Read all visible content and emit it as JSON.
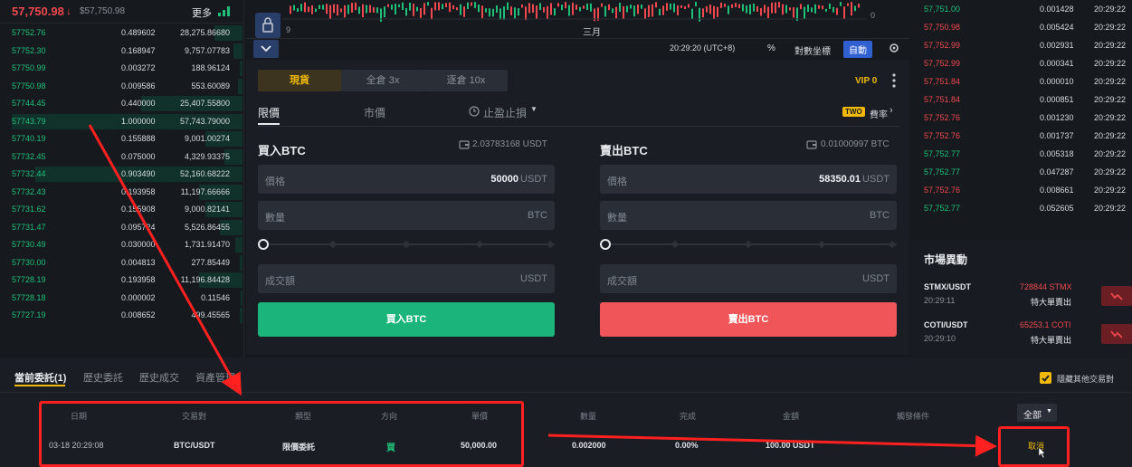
{
  "left_header": {
    "price": "57,750.98",
    "arrow": "↓",
    "sub_price": "$57,750.98",
    "more_label": "更多"
  },
  "left_book": [
    {
      "price": "57752.76",
      "amount": "0.489602",
      "total": "28,275.86680"
    },
    {
      "price": "57752.30",
      "amount": "0.168947",
      "total": "9,757.07783"
    },
    {
      "price": "57750.99",
      "amount": "0.003272",
      "total": "188.96124"
    },
    {
      "price": "57750.98",
      "amount": "0.009586",
      "total": "553.60089"
    },
    {
      "price": "57744.45",
      "amount": "0.440000",
      "total": "25,407.55800"
    },
    {
      "price": "57743.79",
      "amount": "1.000000",
      "total": "57,743.79000"
    },
    {
      "price": "57740.19",
      "amount": "0.155888",
      "total": "9,001.00274"
    },
    {
      "price": "57732.45",
      "amount": "0.075000",
      "total": "4,329.93375"
    },
    {
      "price": "57732.44",
      "amount": "0.903490",
      "total": "52,160.68222"
    },
    {
      "price": "57732.43",
      "amount": "0.193958",
      "total": "11,197.66666"
    },
    {
      "price": "57731.62",
      "amount": "0.155908",
      "total": "9,000.82141"
    },
    {
      "price": "57731.47",
      "amount": "0.095724",
      "total": "5,526.86455"
    },
    {
      "price": "57730.49",
      "amount": "0.030000",
      "total": "1,731.91470"
    },
    {
      "price": "57730.00",
      "amount": "0.004813",
      "total": "277.85449"
    },
    {
      "price": "57728.19",
      "amount": "0.193958",
      "total": "11,196.84428"
    },
    {
      "price": "57728.18",
      "amount": "0.000002",
      "total": "0.11546"
    },
    {
      "price": "57727.19",
      "amount": "0.008652",
      "total": "499.45565"
    }
  ],
  "left_book_depth": [
    0.12,
    0.04,
    0.01,
    0.02,
    0.44,
    1.0,
    0.16,
    0.08,
    0.9,
    0.19,
    0.16,
    0.1,
    0.03,
    0.01,
    0.19,
    0.0,
    0.01
  ],
  "chart": {
    "axis_zero": "0",
    "axis_start": "9",
    "month_label": "三月",
    "toolbar": {
      "time": "20:29:20 (UTC+8)",
      "percent": "%",
      "log": "對數坐標",
      "auto": "自動"
    }
  },
  "trade": {
    "mode_tabs": [
      "現貨",
      "全倉 3x",
      "逐倉 10x"
    ],
    "vip": "VIP 0",
    "order_types": [
      "限價",
      "市價",
      "止盈止損"
    ],
    "fee_badge": "TWO",
    "fee_label": "費率",
    "buy": {
      "title": "買入BTC",
      "balance": "2.03783168 USDT",
      "price_label": "價格",
      "price_value": "50000",
      "price_unit": "USDT",
      "amount_label": "數量",
      "amount_unit": "BTC",
      "total_label": "成交額",
      "total_unit": "USDT",
      "button": "買入BTC"
    },
    "sell": {
      "title": "賣出BTC",
      "balance": "0.01000997 BTC",
      "price_label": "價格",
      "price_value": "58350.01",
      "price_unit": "USDT",
      "amount_label": "數量",
      "amount_unit": "BTC",
      "total_label": "成交額",
      "total_unit": "USDT",
      "button": "賣出BTC"
    }
  },
  "right_trades": [
    {
      "price": "57,751.00",
      "amount": "0.001428",
      "time": "20:29:22",
      "side": "buy"
    },
    {
      "price": "57,750.98",
      "amount": "0.005424",
      "time": "20:29:22",
      "side": "sell"
    },
    {
      "price": "57,752.99",
      "amount": "0.002931",
      "time": "20:29:22",
      "side": "sell"
    },
    {
      "price": "57,752.99",
      "amount": "0.000341",
      "time": "20:29:22",
      "side": "sell"
    },
    {
      "price": "57,751.84",
      "amount": "0.000010",
      "time": "20:29:22",
      "side": "sell"
    },
    {
      "price": "57,751.84",
      "amount": "0.000851",
      "time": "20:29:22",
      "side": "sell"
    },
    {
      "price": "57,752.76",
      "amount": "0.001230",
      "time": "20:29:22",
      "side": "sell"
    },
    {
      "price": "57,752.76",
      "amount": "0.001737",
      "time": "20:29:22",
      "side": "sell"
    },
    {
      "price": "57,752.77",
      "amount": "0.005318",
      "time": "20:29:22",
      "side": "buy"
    },
    {
      "price": "57,752.77",
      "amount": "0.047287",
      "time": "20:29:22",
      "side": "buy"
    },
    {
      "price": "57,752.76",
      "amount": "0.008661",
      "time": "20:29:22",
      "side": "sell"
    },
    {
      "price": "57,752.77",
      "amount": "0.052605",
      "time": "20:29:22",
      "side": "buy"
    }
  ],
  "market": {
    "title": "市場異動",
    "items": [
      {
        "pair": "STMX/USDT",
        "time": "20:29:11",
        "amount": "728844 STMX",
        "desc": "特大單賣出"
      },
      {
        "pair": "COTI/USDT",
        "time": "20:29:10",
        "amount": "65253.1 COTI",
        "desc": "特大單賣出"
      }
    ]
  },
  "bottom": {
    "tabs": [
      "當前委託(1)",
      "歷史委託",
      "歷史成交",
      "資產管理"
    ],
    "hide_others": "隱藏其他交易對",
    "filter": "全部",
    "headers": [
      "日期",
      "交易對",
      "類型",
      "方向",
      "單價",
      "數量",
      "完成",
      "金額",
      "觸發條件"
    ],
    "row": {
      "date": "03-18 20:29:08",
      "pair": "BTC/USDT",
      "type": "限價委託",
      "side": "買",
      "price": "50,000.00",
      "amount": "0.002000",
      "filled": "0.00%",
      "total": "100.00 USDT",
      "trigger": "",
      "cancel": "取消"
    }
  },
  "colors": {
    "green": "#1fbf7a",
    "red": "#f0484f",
    "accent": "#f0b90b",
    "arrow": "#ff2020"
  }
}
